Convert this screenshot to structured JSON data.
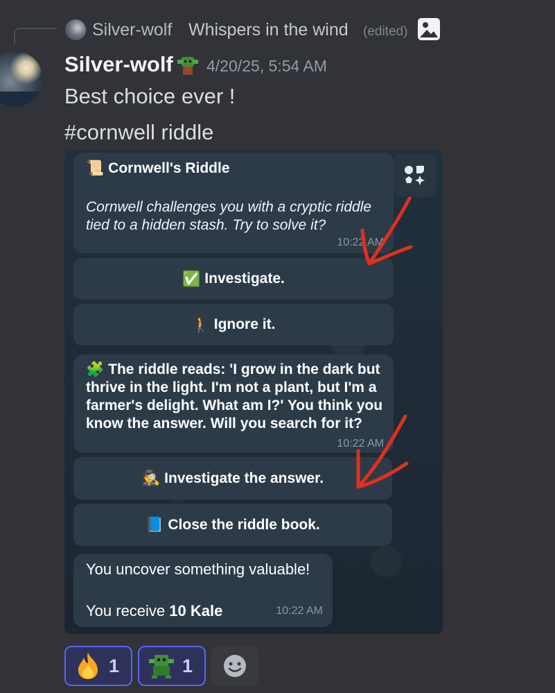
{
  "reply": {
    "author": "Silver-wolf",
    "text": "Whispers in the wind",
    "edited": "(edited)"
  },
  "message": {
    "author": "Silver-wolf",
    "timestamp": "4/20/25, 5:54 AM",
    "line1": "Best choice ever !",
    "line2": "#cornwell riddle"
  },
  "screenshot": {
    "bubble1": {
      "title_emoji": "📜",
      "title": "Cornwell's Riddle",
      "body": "Cornwell challenges you with a cryptic riddle tied to a hidden stash. Try to solve it?",
      "time": "10:22 AM"
    },
    "buttons": [
      {
        "emoji": "✅",
        "label": "Investigate."
      },
      {
        "emoji": "🚶",
        "label": "Ignore it."
      },
      {
        "emoji": "🕵",
        "label": "Investigate the answer."
      },
      {
        "emoji": "📘",
        "label": "Close the riddle book."
      }
    ],
    "bubble2": {
      "emoji": "🧩",
      "body": "The riddle reads: 'I grow in the dark but thrive in the light. I'm not a plant, but I'm a farmer's delight. What am I?' You think you know the answer. Will you search for it?",
      "time": "10:22 AM"
    },
    "bubble3": {
      "line1": "You uncover something valuable!",
      "line2_prefix": "You receive ",
      "line2_bold": "10 Kale",
      "time": "10:22 AM"
    }
  },
  "reactions": [
    {
      "emoji_name": "fire",
      "count": "1"
    },
    {
      "emoji_name": "green-creature",
      "count": "1"
    }
  ],
  "colors": {
    "background": "#313338",
    "accent": "#5865f2",
    "annotation_arrow": "#e0301e"
  }
}
